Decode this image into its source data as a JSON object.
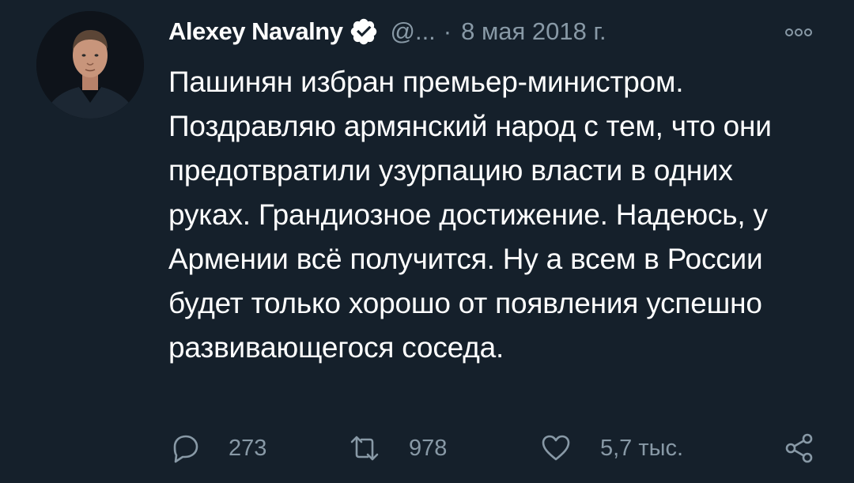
{
  "author": {
    "display_name": "Alexey Navalny",
    "handle": "@...",
    "separator": "·",
    "date": "8 мая 2018 г.",
    "verified": true
  },
  "tweet": {
    "text": "Пашинян избран премьер-министром. Поздравляю армянский народ с тем, что они предотвратили узурпацию власти в одних руках. Грандиозное достижение. Надеюсь, у Армении всё получится. Ну а всем в России будет только хорошо от появления успешно развивающегося соседа."
  },
  "actions": {
    "reply_count": "273",
    "retweet_count": "978",
    "like_count": "5,7 тыс."
  },
  "icons": {
    "verified": "verified-badge-icon",
    "more": "more-options-icon",
    "reply": "reply-icon",
    "retweet": "retweet-icon",
    "like": "heart-icon",
    "share": "share-icon"
  },
  "colors": {
    "background": "#15202b",
    "text": "#ffffff",
    "secondary": "#8899a6"
  }
}
